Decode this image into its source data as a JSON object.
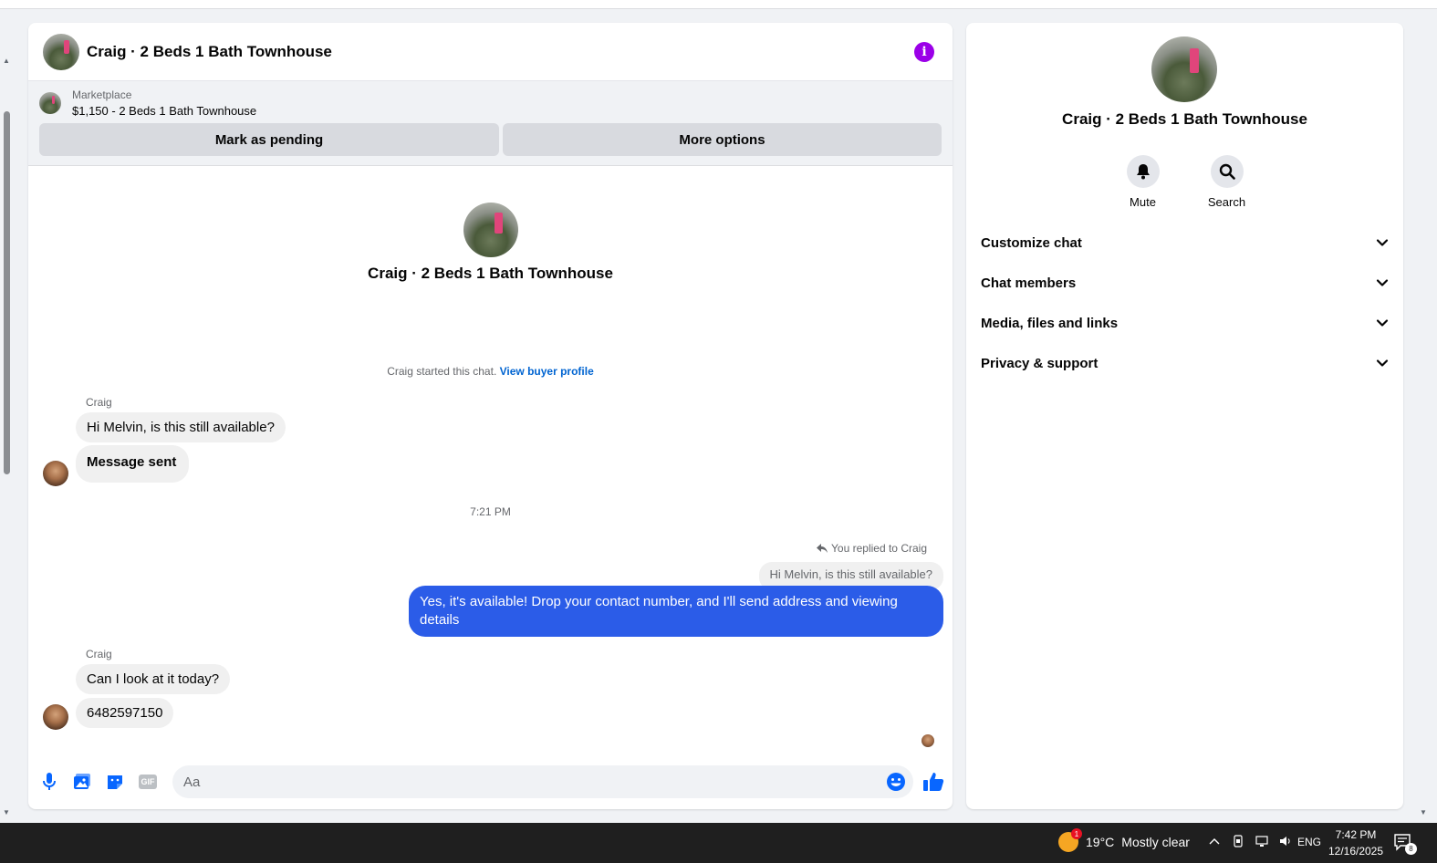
{
  "chat": {
    "title": "Craig · 2 Beds 1 Bath Townhouse",
    "marketplace": {
      "label": "Marketplace",
      "listing": "$1,150 - 2 Beds 1 Bath Townhouse",
      "pending_button": "Mark as pending",
      "more_button": "More options"
    },
    "intro_title": "Craig · 2 Beds 1 Bath Townhouse",
    "started_text": "Craig started this chat.",
    "buyer_profile_link": "View buyer profile",
    "group1": {
      "sender": "Craig",
      "messages": [
        "Hi Melvin, is this still available?",
        "Message sent"
      ]
    },
    "time_separator": "7:21 PM",
    "reply": {
      "label": "You replied to Craig",
      "quoted": "Hi Melvin, is this still available?",
      "message": "Yes, it's available! Drop your contact number, and I'll send address and viewing details"
    },
    "group2": {
      "sender": "Craig",
      "messages": [
        "Can I look at it today?",
        "6482597150"
      ]
    },
    "composer": {
      "placeholder": "Aa"
    }
  },
  "sidebar": {
    "title": "Craig · 2 Beds 1 Bath Townhouse",
    "actions": [
      {
        "label": "Mute",
        "icon": "bell-icon"
      },
      {
        "label": "Search",
        "icon": "search-icon"
      }
    ],
    "menu": [
      {
        "label": "Customize chat"
      },
      {
        "label": "Chat members"
      },
      {
        "label": "Media, files and links"
      },
      {
        "label": "Privacy & support"
      }
    ]
  },
  "taskbar": {
    "weather_temp": "19°C",
    "weather_desc": "Mostly clear",
    "weather_badge": "1",
    "lang": "ENG",
    "time": "7:42 PM",
    "date": "12/16/2025",
    "notifications": "8"
  },
  "colors": {
    "accent": "#0084ff",
    "outgoing_bubble": "#2b5ce8",
    "info": "#9b00e8",
    "link": "#0064d1"
  }
}
